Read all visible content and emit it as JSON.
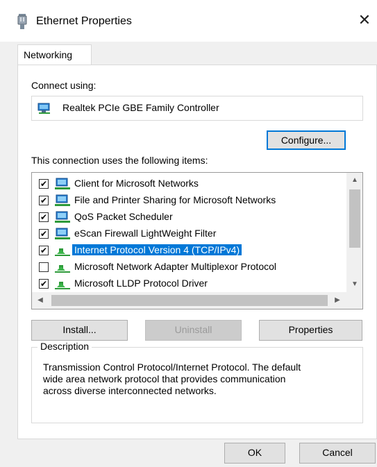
{
  "window": {
    "title": "Ethernet Properties",
    "close_glyph": "✕",
    "icon": "network-adapter-icon"
  },
  "tabs": [
    {
      "label": "Networking",
      "selected": true
    }
  ],
  "connect_using": {
    "label": "Connect using:",
    "adapter_name": "Realtek PCIe GBE Family Controller",
    "adapter_icon": "network-adapter-icon"
  },
  "configure_button": "Configure...",
  "items_label": "This connection uses the following items:",
  "items": [
    {
      "label": "Client for Microsoft Networks",
      "checked": true,
      "icon": "network-client-icon"
    },
    {
      "label": "File and Printer Sharing for Microsoft Networks",
      "checked": true,
      "icon": "network-service-icon"
    },
    {
      "label": "QoS Packet Scheduler",
      "checked": true,
      "icon": "network-service-icon"
    },
    {
      "label": "eScan Firewall LightWeight Filter",
      "checked": true,
      "icon": "network-service-icon"
    },
    {
      "label": "Internet Protocol Version 4 (TCP/IPv4)",
      "checked": true,
      "selected": true,
      "icon": "protocol-icon"
    },
    {
      "label": "Microsoft Network Adapter Multiplexor Protocol",
      "checked": false,
      "icon": "protocol-icon"
    },
    {
      "label": "Microsoft LLDP Protocol Driver",
      "checked": true,
      "icon": "protocol-icon"
    }
  ],
  "buttons": {
    "install": "Install...",
    "uninstall": "Uninstall",
    "properties": "Properties",
    "ok": "OK",
    "cancel": "Cancel"
  },
  "description": {
    "legend": "Description",
    "lines": [
      "Transmission Control Protocol/Internet Protocol. The default",
      "wide area network protocol that provides communication",
      "across diverse interconnected networks."
    ]
  },
  "colors": {
    "selection": "#0078d7",
    "dialog_bg": "#f0f0f0",
    "focus_border": "#0078d7"
  }
}
